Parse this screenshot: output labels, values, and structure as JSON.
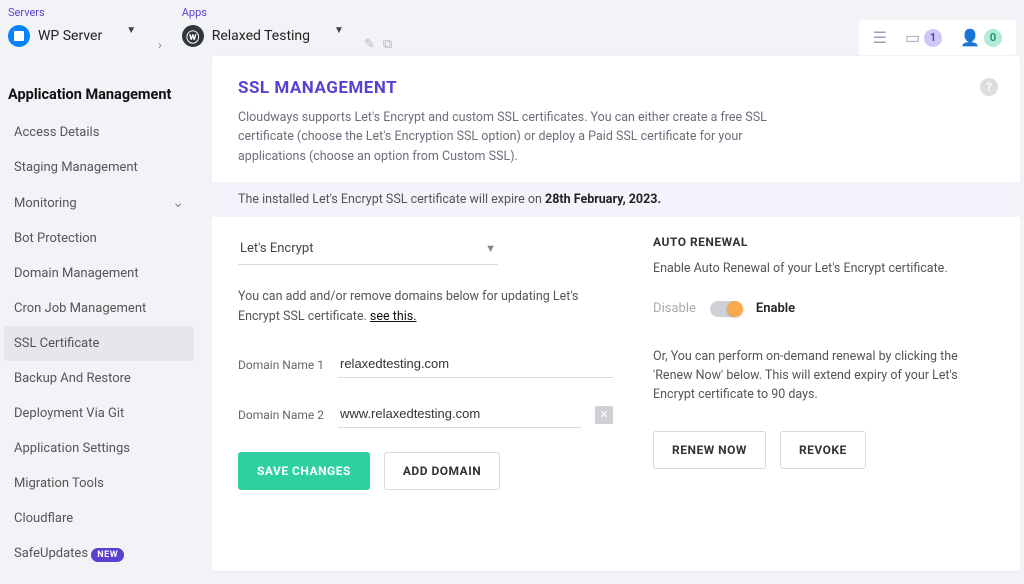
{
  "breadcrumb": {
    "servers_label": "Servers",
    "server_name": "WP Server",
    "apps_label": "Apps",
    "app_name": "Relaxed Testing"
  },
  "topright": {
    "apps_count": "1",
    "user_count": "0"
  },
  "sidebar": {
    "heading": "Application Management",
    "items": [
      {
        "label": "Access Details"
      },
      {
        "label": "Staging Management"
      },
      {
        "label": "Monitoring",
        "chev": true
      },
      {
        "label": "Bot Protection"
      },
      {
        "label": "Domain Management"
      },
      {
        "label": "Cron Job Management"
      },
      {
        "label": "SSL Certificate",
        "active": true
      },
      {
        "label": "Backup And Restore"
      },
      {
        "label": "Deployment Via Git"
      },
      {
        "label": "Application Settings"
      },
      {
        "label": "Migration Tools"
      },
      {
        "label": "Cloudflare"
      },
      {
        "label": "SafeUpdates",
        "new": true
      }
    ],
    "new_badge": "NEW"
  },
  "panel": {
    "title": "SSL MANAGEMENT",
    "desc": "Cloudways supports Let's Encrypt and custom SSL certificates. You can either create a free SSL certificate (choose the Let's Encryption SSL option) or deploy a Paid SSL certificate for your applications (choose an option from Custom SSL).",
    "expire_pre": "The installed Let's Encrypt SSL certificate will expire on ",
    "expire_date": "28th February, 2023.",
    "cert_type": "Let's Encrypt",
    "hint_text": "You can add and/or remove domains below for updating Let's Encrypt SSL certificate.   ",
    "hint_link": "see this.",
    "domain1_label": "Domain Name 1",
    "domain1_value": "relaxedtesting.com",
    "domain2_label": "Domain Name 2",
    "domain2_value": "www.relaxedtesting.com",
    "save_btn": "SAVE CHANGES",
    "add_btn": "ADD DOMAIN",
    "auto_title": "AUTO RENEWAL",
    "auto_sub": "Enable Auto Renewal of your Let's Encrypt certificate.",
    "disable": "Disable",
    "enable": "Enable",
    "renew_text": "Or, You can perform on-demand renewal by clicking the 'Renew Now' below. This will extend expiry of your Let's Encrypt certificate to 90 days.",
    "renew_btn": "RENEW NOW",
    "revoke_btn": "REVOKE"
  }
}
